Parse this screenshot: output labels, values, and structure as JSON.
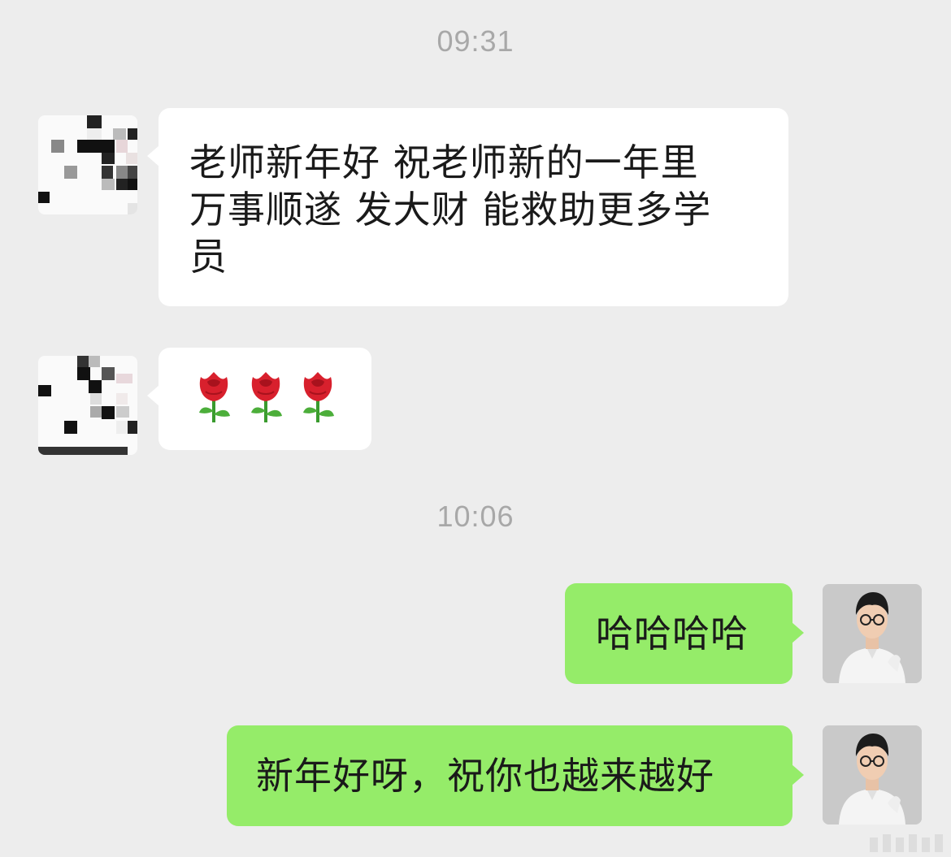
{
  "chat": {
    "timestamp_1": "09:31",
    "timestamp_2": "10:06",
    "messages": [
      {
        "sender": "contact",
        "text": "老师新年好 祝老师新的一年里\n万事顺遂 发大财 能救助更多学\n员"
      },
      {
        "sender": "contact",
        "emoji": [
          "rose-emoji",
          "rose-emoji",
          "rose-emoji"
        ]
      },
      {
        "sender": "self",
        "text": "哈哈哈哈"
      },
      {
        "sender": "self",
        "text": "新年好呀，祝你也越来越好"
      }
    ]
  },
  "colors": {
    "background": "#ededed",
    "incoming_bubble": "#ffffff",
    "outgoing_bubble": "#95ec69",
    "timestamp_text": "#a8a8a8",
    "message_text": "#1a1a1a"
  },
  "icons": {
    "contact_avatar": "pixelated-avatar",
    "self_avatar": "person-photo-avatar",
    "rose": "rose-emoji"
  }
}
